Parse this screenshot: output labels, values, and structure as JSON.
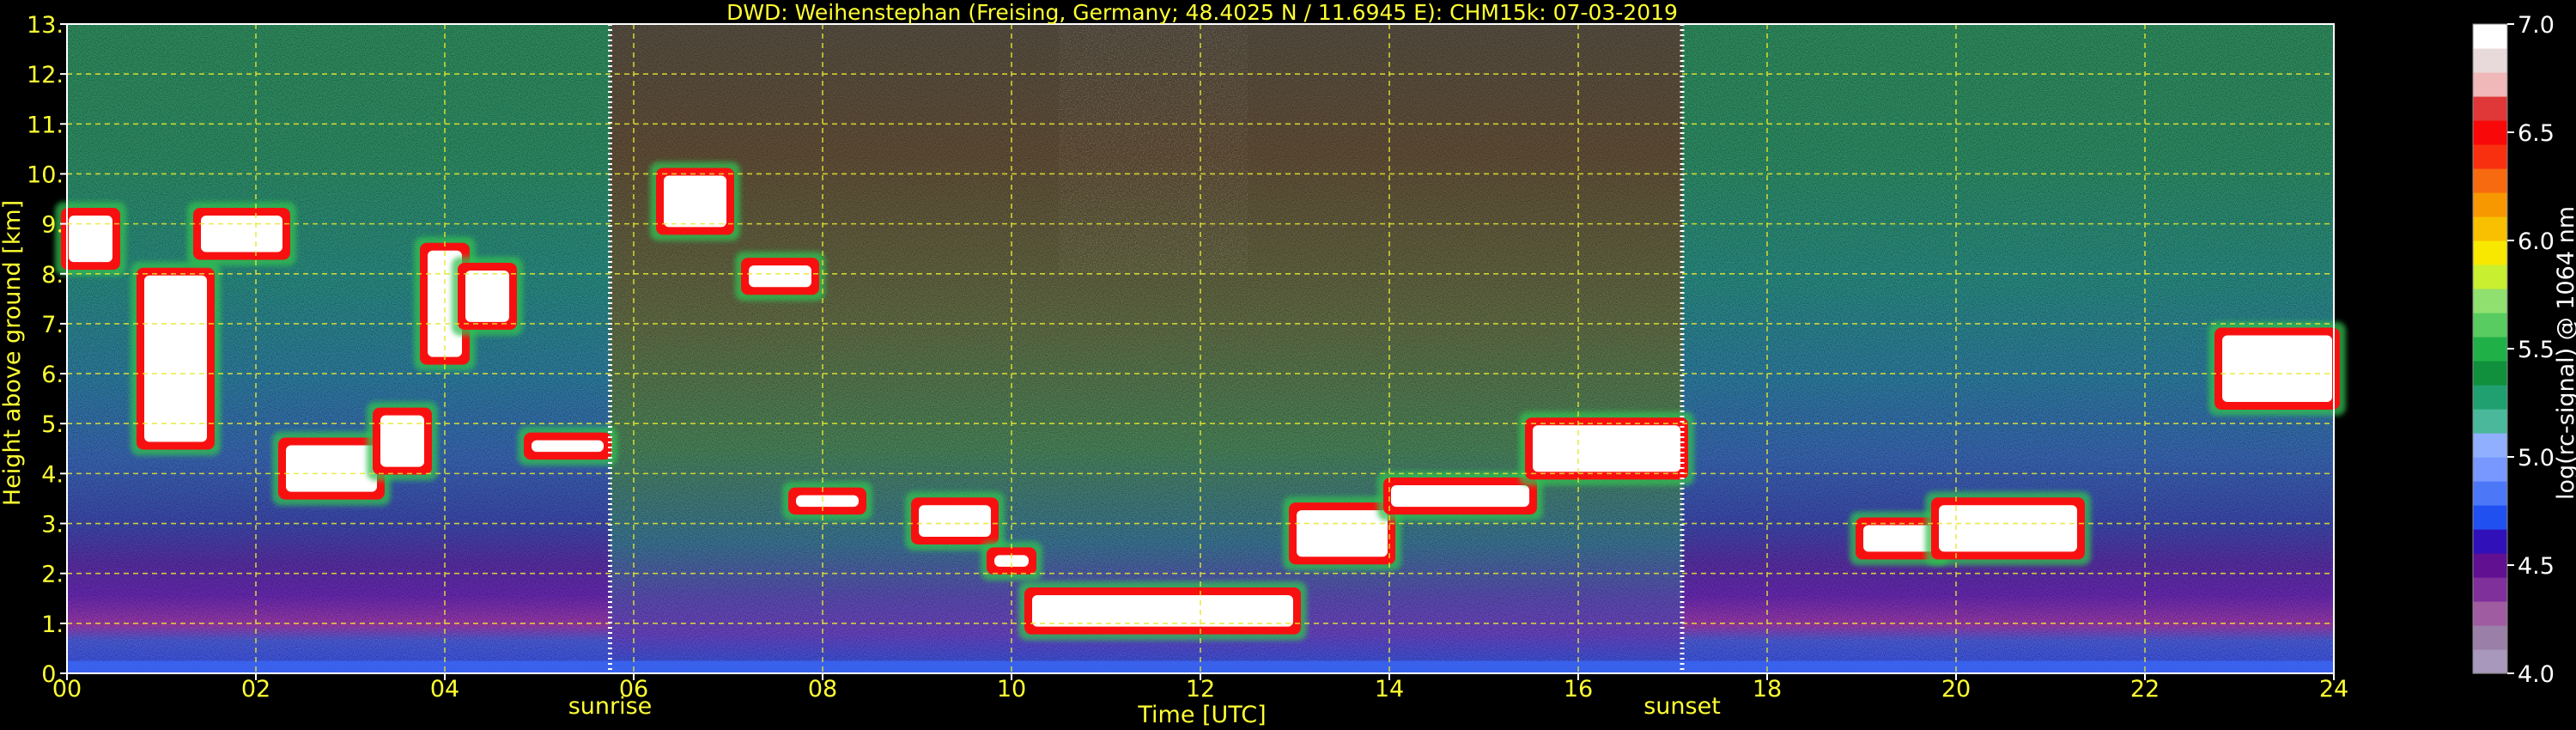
{
  "chart_data": {
    "type": "heatmap",
    "title": "DWD: Weihenstephan (Freising, Germany; 48.4025 N / 11.6945 E):    CHM15k: 07-03-2019",
    "xlabel": "Time [UTC]",
    "ylabel": "Height above ground [km]",
    "xlim": [
      0,
      24
    ],
    "ylim": [
      0,
      13
    ],
    "x_ticks": [
      0,
      2,
      4,
      6,
      8,
      10,
      12,
      14,
      16,
      18,
      20,
      22,
      24
    ],
    "x_tick_labels": [
      "00",
      "02",
      "04",
      "06",
      "08",
      "10",
      "12",
      "14",
      "16",
      "18",
      "20",
      "22",
      "24"
    ],
    "y_ticks": [
      0,
      1,
      2,
      3,
      4,
      5,
      6,
      7,
      8,
      9,
      10,
      11,
      12,
      13
    ],
    "y_tick_labels": [
      "0.",
      "1.",
      "2.",
      "3.",
      "4.",
      "5.",
      "6.",
      "7.",
      "8.",
      "9.",
      "10.",
      "11.",
      "12.",
      "13."
    ],
    "grid": true,
    "colorbar": {
      "label": "log(rc-signal) @ 1064 nm",
      "range": [
        4.0,
        7.0
      ],
      "ticks": [
        4.0,
        4.5,
        5.0,
        5.5,
        6.0,
        6.5,
        7.0
      ],
      "tick_labels": [
        "4.0",
        "4.5",
        "5.0",
        "5.5",
        "6.0",
        "6.5",
        "7.0"
      ],
      "colors": [
        "#a898bc",
        "#9a80a8",
        "#a05ca0",
        "#80309a",
        "#601090",
        "#3010b8",
        "#2050f0",
        "#4c78f8",
        "#7898ff",
        "#90b0ff",
        "#4ab89a",
        "#20a070",
        "#10903c",
        "#20b048",
        "#58cc60",
        "#90e070",
        "#c8ef30",
        "#f8e800",
        "#f8c000",
        "#f89800",
        "#f86a10",
        "#f83010",
        "#f80808",
        "#e03838",
        "#f0b8b8",
        "#e8dada",
        "#ffffff"
      ]
    },
    "events": [
      {
        "label": "sunrise",
        "time": 5.75
      },
      {
        "label": "sunset",
        "time": 17.1
      }
    ],
    "cloud_layers": [
      {
        "start": 0.0,
        "end": 0.5,
        "base_km": 8.2,
        "top_km": 9.2
      },
      {
        "start": 0.8,
        "end": 1.5,
        "base_km": 4.6,
        "top_km": 8.0
      },
      {
        "start": 1.4,
        "end": 2.3,
        "base_km": 8.4,
        "top_km": 9.2
      },
      {
        "start": 2.3,
        "end": 3.3,
        "base_km": 3.6,
        "top_km": 4.6
      },
      {
        "start": 3.3,
        "end": 3.8,
        "base_km": 4.1,
        "top_km": 5.2
      },
      {
        "start": 3.8,
        "end": 4.2,
        "base_km": 6.3,
        "top_km": 8.5
      },
      {
        "start": 4.2,
        "end": 4.7,
        "base_km": 7.0,
        "top_km": 8.1
      },
      {
        "start": 4.9,
        "end": 5.7,
        "base_km": 4.4,
        "top_km": 4.7
      },
      {
        "start": 6.3,
        "end": 7.0,
        "base_km": 8.9,
        "top_km": 10.0
      },
      {
        "start": 7.2,
        "end": 7.9,
        "base_km": 7.7,
        "top_km": 8.2
      },
      {
        "start": 7.7,
        "end": 8.4,
        "base_km": 3.3,
        "top_km": 3.6
      },
      {
        "start": 9.0,
        "end": 9.8,
        "base_km": 2.7,
        "top_km": 3.4
      },
      {
        "start": 9.8,
        "end": 10.2,
        "base_km": 2.1,
        "top_km": 2.4
      },
      {
        "start": 10.2,
        "end": 13.0,
        "base_km": 0.9,
        "top_km": 1.6
      },
      {
        "start": 13.0,
        "end": 14.0,
        "base_km": 2.3,
        "top_km": 3.3
      },
      {
        "start": 14.0,
        "end": 15.5,
        "base_km": 3.3,
        "top_km": 3.8
      },
      {
        "start": 15.5,
        "end": 17.1,
        "base_km": 4.0,
        "top_km": 5.0
      },
      {
        "start": 19.0,
        "end": 19.8,
        "base_km": 2.4,
        "top_km": 3.0
      },
      {
        "start": 19.8,
        "end": 21.3,
        "base_km": 2.4,
        "top_km": 3.4
      },
      {
        "start": 22.8,
        "end": 24.0,
        "base_km": 5.4,
        "top_km": 6.8
      }
    ]
  }
}
